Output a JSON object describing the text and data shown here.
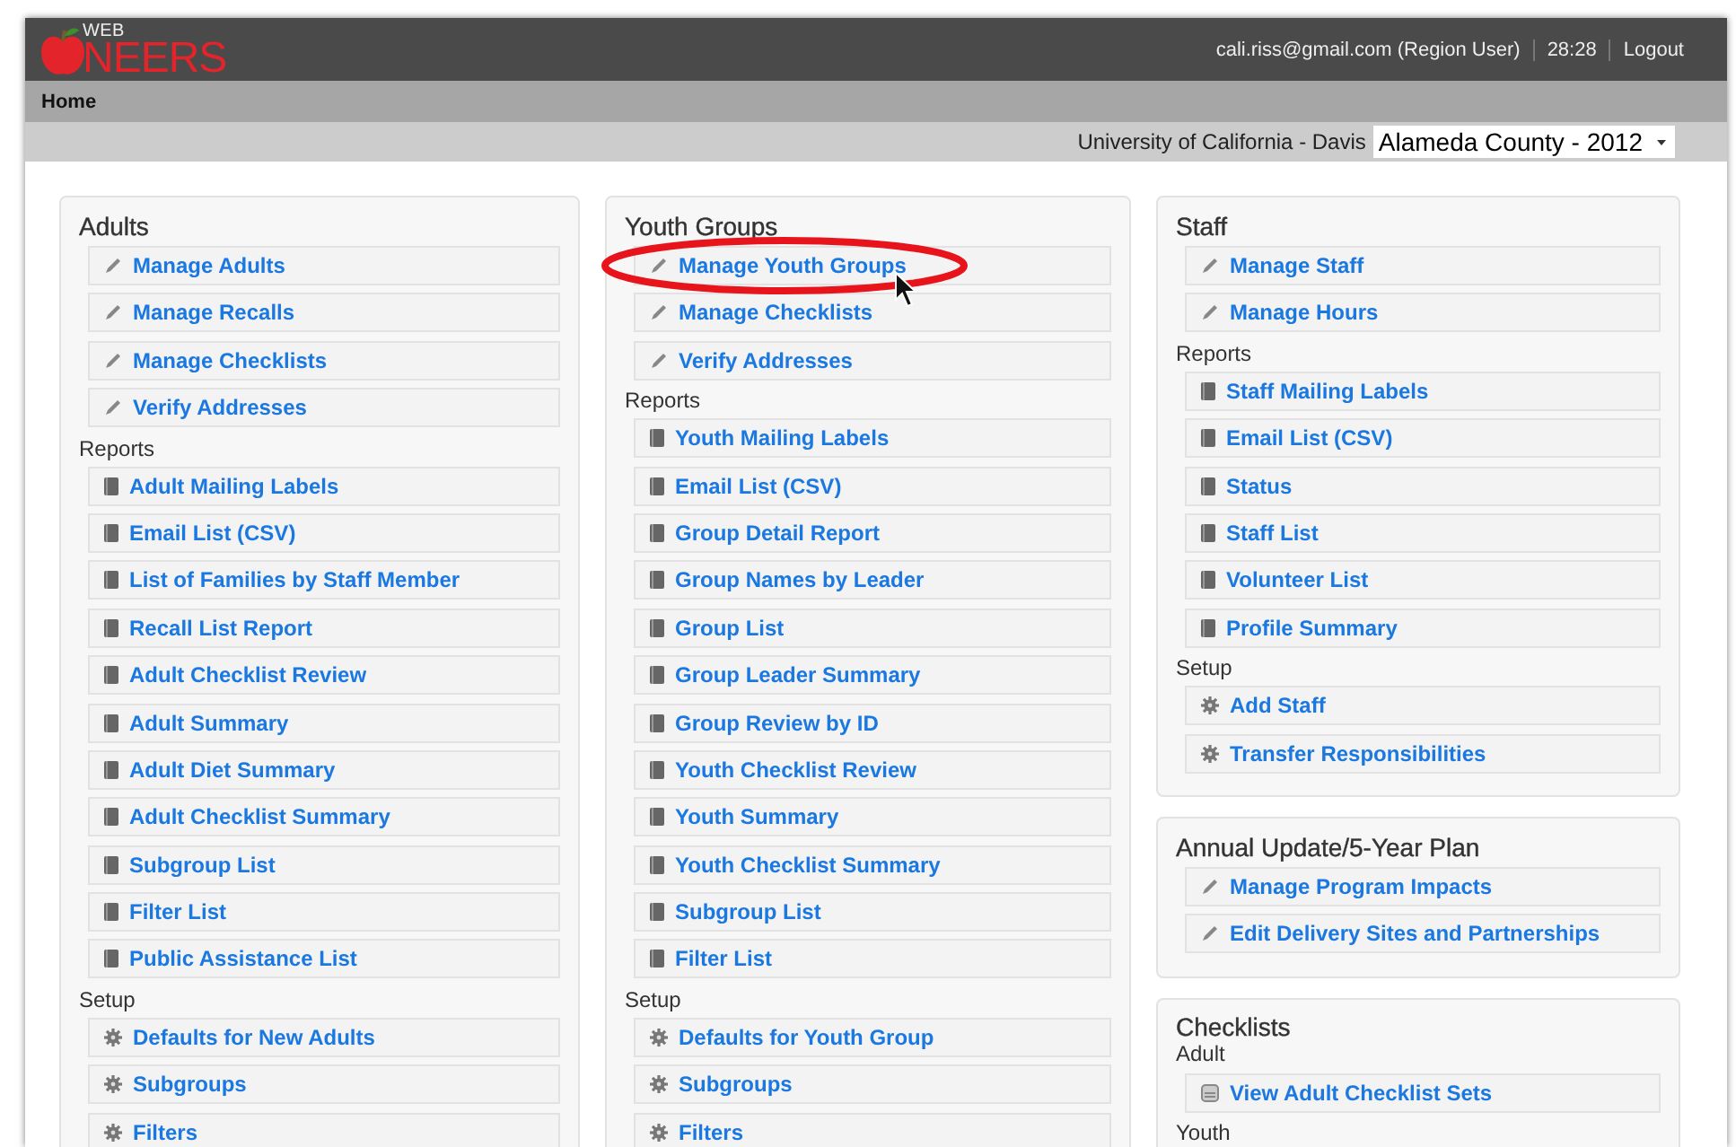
{
  "header": {
    "logo": {
      "word_top": "WEB",
      "word_main": "NEERS"
    },
    "user": "cali.riss@gmail.com (Region User)",
    "timer": "28:28",
    "logout": "Logout"
  },
  "nav": {
    "items": [
      {
        "label": "Home",
        "selected": true
      }
    ]
  },
  "context": {
    "institution": "University of California - Davis",
    "county_select": {
      "value": "Alameda County - 2012"
    }
  },
  "columns": [
    {
      "panels": [
        {
          "title": "Adults",
          "groups": [
            {
              "items": [
                {
                  "label": "Manage Adults",
                  "kind": "edit"
                },
                {
                  "label": "Manage Recalls",
                  "kind": "edit"
                },
                {
                  "label": "Manage Checklists",
                  "kind": "edit"
                },
                {
                  "label": "Verify Addresses",
                  "kind": "edit"
                }
              ]
            },
            {
              "heading": "Reports",
              "items": [
                {
                  "label": "Adult Mailing Labels",
                  "kind": "report"
                },
                {
                  "label": "Email List (CSV)",
                  "kind": "report"
                },
                {
                  "label": "List of Families by Staff Member",
                  "kind": "report"
                },
                {
                  "label": "Recall List Report",
                  "kind": "report"
                },
                {
                  "label": "Adult Checklist Review",
                  "kind": "report"
                },
                {
                  "label": "Adult Summary",
                  "kind": "report"
                },
                {
                  "label": "Adult Diet Summary",
                  "kind": "report"
                },
                {
                  "label": "Adult Checklist Summary",
                  "kind": "report"
                },
                {
                  "label": "Subgroup List",
                  "kind": "report"
                },
                {
                  "label": "Filter List",
                  "kind": "report"
                },
                {
                  "label": "Public Assistance List",
                  "kind": "report"
                }
              ]
            },
            {
              "heading": "Setup",
              "items": [
                {
                  "label": "Defaults for New Adults",
                  "kind": "setup"
                },
                {
                  "label": "Subgroups",
                  "kind": "setup"
                },
                {
                  "label": "Filters",
                  "kind": "setup"
                }
              ]
            }
          ]
        }
      ]
    },
    {
      "panels": [
        {
          "title": "Youth Groups",
          "groups": [
            {
              "items": [
                {
                  "label": "Manage Youth Groups",
                  "kind": "edit"
                },
                {
                  "label": "Manage Checklists",
                  "kind": "edit"
                },
                {
                  "label": "Verify Addresses",
                  "kind": "edit"
                }
              ]
            },
            {
              "heading": "Reports",
              "items": [
                {
                  "label": "Youth Mailing Labels",
                  "kind": "report"
                },
                {
                  "label": "Email List (CSV)",
                  "kind": "report"
                },
                {
                  "label": "Group Detail Report",
                  "kind": "report"
                },
                {
                  "label": "Group Names by Leader",
                  "kind": "report"
                },
                {
                  "label": "Group List",
                  "kind": "report"
                },
                {
                  "label": "Group Leader Summary",
                  "kind": "report"
                },
                {
                  "label": "Group Review by ID",
                  "kind": "report"
                },
                {
                  "label": "Youth Checklist Review",
                  "kind": "report"
                },
                {
                  "label": "Youth Summary",
                  "kind": "report"
                },
                {
                  "label": "Youth Checklist Summary",
                  "kind": "report"
                },
                {
                  "label": "Subgroup List",
                  "kind": "report"
                },
                {
                  "label": "Filter List",
                  "kind": "report"
                }
              ]
            },
            {
              "heading": "Setup",
              "items": [
                {
                  "label": "Defaults for Youth Group",
                  "kind": "setup"
                },
                {
                  "label": "Subgroups",
                  "kind": "setup"
                },
                {
                  "label": "Filters",
                  "kind": "setup"
                }
              ]
            }
          ]
        }
      ]
    },
    {
      "panels": [
        {
          "title": "Staff",
          "groups": [
            {
              "items": [
                {
                  "label": "Manage Staff",
                  "kind": "edit"
                },
                {
                  "label": "Manage Hours",
                  "kind": "edit"
                }
              ]
            },
            {
              "heading": "Reports",
              "items": [
                {
                  "label": "Staff Mailing Labels",
                  "kind": "report"
                },
                {
                  "label": "Email List (CSV)",
                  "kind": "report"
                },
                {
                  "label": "Status",
                  "kind": "report"
                },
                {
                  "label": "Staff List",
                  "kind": "report"
                },
                {
                  "label": "Volunteer List",
                  "kind": "report"
                },
                {
                  "label": "Profile Summary",
                  "kind": "report"
                }
              ]
            },
            {
              "heading": "Setup",
              "items": [
                {
                  "label": "Add Staff",
                  "kind": "setup"
                },
                {
                  "label": "Transfer Responsibilities",
                  "kind": "setup"
                }
              ]
            }
          ]
        },
        {
          "title": "Annual Update/5-Year Plan",
          "groups": [
            {
              "items": [
                {
                  "label": "Manage Program Impacts",
                  "kind": "edit"
                },
                {
                  "label": "Edit Delivery Sites and Partnerships",
                  "kind": "edit"
                }
              ]
            }
          ]
        },
        {
          "title": "Checklists",
          "groups": [
            {
              "heading": "Adult",
              "items": [
                {
                  "label": "View Adult Checklist Sets",
                  "kind": "checklist"
                }
              ]
            },
            {
              "heading": "Youth"
            }
          ]
        }
      ]
    }
  ]
}
